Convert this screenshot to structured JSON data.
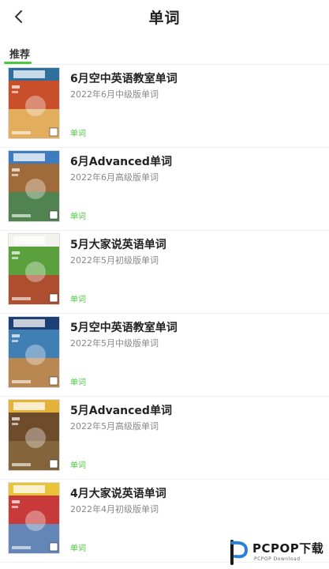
{
  "header": {
    "title": "单词"
  },
  "tabs": [
    {
      "label": "推荐",
      "active": true
    }
  ],
  "accent_color": "#4cc93f",
  "items": [
    {
      "title": "6月空中英语教室单词",
      "subtitle": "2022年6月中级版单词",
      "tag": "单词",
      "cover_colors": [
        "#2f6f9e",
        "#c94f2a",
        "#e8c46a"
      ]
    },
    {
      "title": "6月Advanced单词",
      "subtitle": "2022年6月高级版单词",
      "tag": "单词",
      "cover_colors": [
        "#3d7cc0",
        "#a06b3a",
        "#3d8a57"
      ]
    },
    {
      "title": "5月大家说英语单词",
      "subtitle": "2022年5月初级版单词",
      "tag": "单词",
      "cover_colors": [
        "#f3f3ee",
        "#5aa03c",
        "#c23a2a"
      ]
    },
    {
      "title": "5月空中英语教室单词",
      "subtitle": "2022年5月中级版单词",
      "tag": "单词",
      "cover_colors": [
        "#1d3f73",
        "#3f7fb3",
        "#d88a3a"
      ]
    },
    {
      "title": "5月Advanced单词",
      "subtitle": "2022年5月高级版单词",
      "tag": "单词",
      "cover_colors": [
        "#e4b23b",
        "#6e4b2a",
        "#8a6a3f"
      ]
    },
    {
      "title": "4月大家说英语单词",
      "subtitle": "2022年4月初级版单词",
      "tag": "单词",
      "cover_colors": [
        "#e8c43a",
        "#c83a3a",
        "#4a9ad6"
      ]
    }
  ],
  "watermark": {
    "brand": "PCPOP下载",
    "sub": "PCPOP Download"
  }
}
